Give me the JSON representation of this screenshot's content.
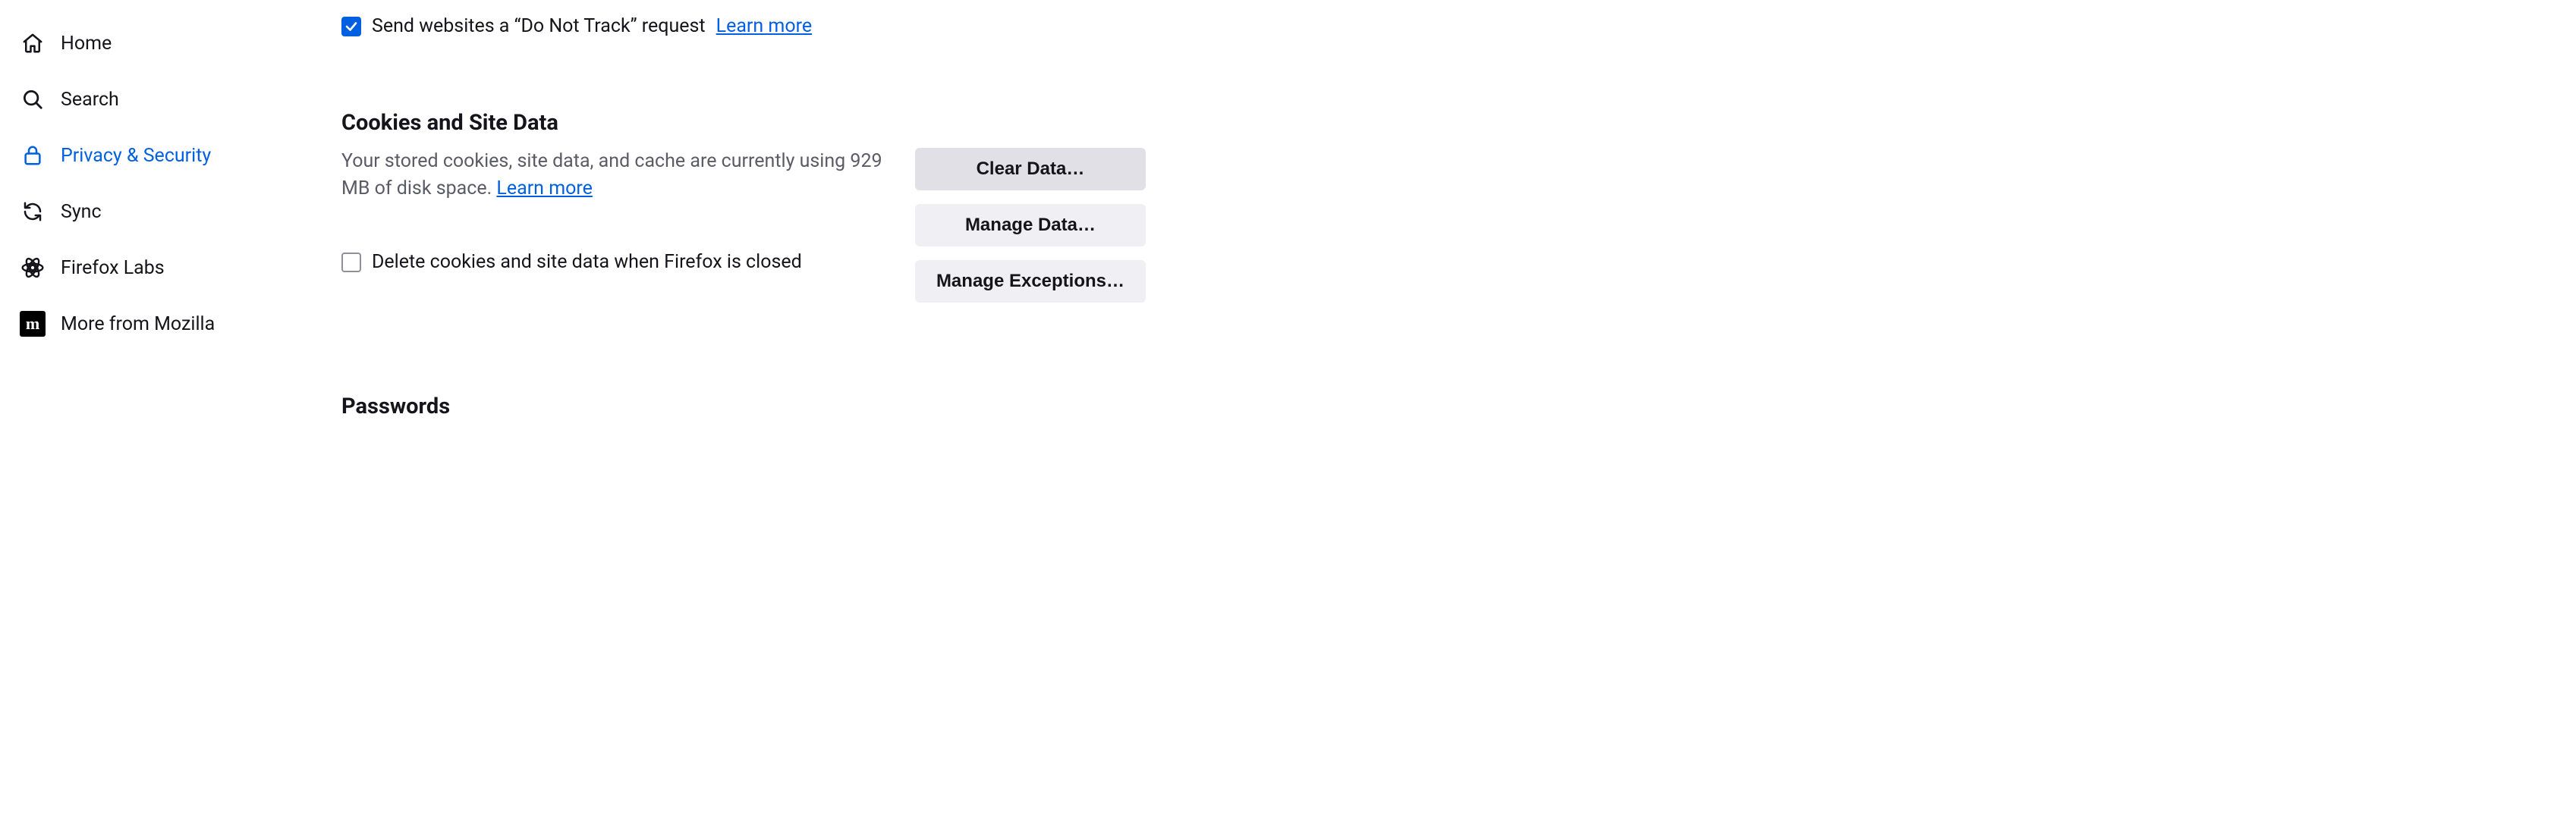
{
  "sidebar": {
    "items": [
      {
        "label": "Home"
      },
      {
        "label": "Search"
      },
      {
        "label": "Privacy & Security"
      },
      {
        "label": "Sync"
      },
      {
        "label": "Firefox Labs"
      },
      {
        "label": "More from Mozilla"
      }
    ]
  },
  "dnt": {
    "label": "Send websites a “Do Not Track” request",
    "learn_more": "Learn more"
  },
  "cookies": {
    "heading": "Cookies and Site Data",
    "desc_prefix": "Your stored cookies, site data, and cache are currently using ",
    "size": "929 MB",
    "desc_suffix": " of disk space. ",
    "learn_more": "Learn more",
    "delete_on_close": "Delete cookies and site data when Firefox is closed",
    "buttons": {
      "clear": "Clear Data…",
      "manage": "Manage Data…",
      "exceptions": "Manage Exceptions…"
    }
  },
  "passwords": {
    "heading": "Passwords"
  }
}
